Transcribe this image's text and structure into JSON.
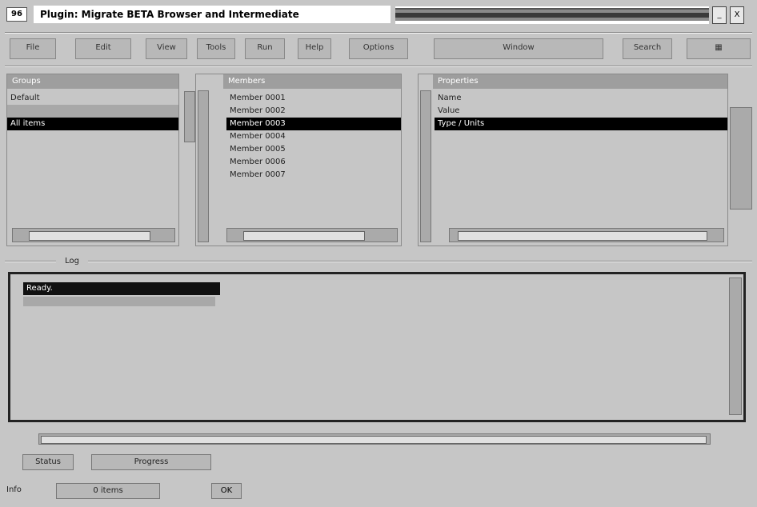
{
  "window": {
    "icon_text": "96",
    "title": "Plugin: Migrate BETA Browser and Intermediate",
    "btn_minimize": "_",
    "btn_close": "X"
  },
  "toolbar": {
    "items": [
      "File",
      "Edit",
      "View",
      "Tools",
      "Run",
      "Help",
      "Options",
      "Window",
      "Search"
    ]
  },
  "panes": {
    "left": {
      "header": "Groups",
      "rows": [
        "Default",
        "All items"
      ]
    },
    "middle": {
      "header": "Members",
      "rows": [
        "Member 0001",
        "Member 0002",
        "Member 0003",
        "Member 0004",
        "Member 0005",
        "Member 0006",
        "Member 0007"
      ]
    },
    "right": {
      "header": "Properties",
      "rows": [
        "Name",
        "Value",
        "Type / Units"
      ]
    }
  },
  "splitter_label": "Log",
  "output": {
    "line": "Ready."
  },
  "status": {
    "left_label": "Status",
    "mid_label": "Progress",
    "bottom_label": "Info",
    "bottom_value": "0 items",
    "small_button": "OK"
  }
}
